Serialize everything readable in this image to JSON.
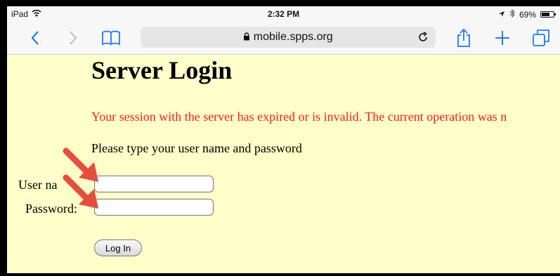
{
  "status_bar": {
    "device": "iPad",
    "time": "2:32 PM",
    "battery": "69%",
    "icons": [
      "wifi-icon",
      "location-arrow-icon",
      "bluetooth-icon",
      "battery-icon"
    ]
  },
  "toolbar": {
    "address": "mobile.spps.org",
    "icons": [
      "back-chevron-icon",
      "forward-chevron-icon",
      "bookmarks-book-icon",
      "lock-icon",
      "reload-icon",
      "share-icon",
      "new-tab-plus-icon",
      "tabs-overview-icon"
    ]
  },
  "page": {
    "title": "Server Login",
    "error_message": "Your session with the server has expired or is invalid. The current operation was n",
    "prompt": "Please type your user name and password",
    "username_label": "User na",
    "password_label": "Password:",
    "username_value": "",
    "password_value": "",
    "login_button": "Log In"
  },
  "colors": {
    "page_background": "#feffc8",
    "error_text": "#ff1a1a",
    "accent_blue": "#1a7cf5",
    "arrow_red": "#e84c3d"
  }
}
